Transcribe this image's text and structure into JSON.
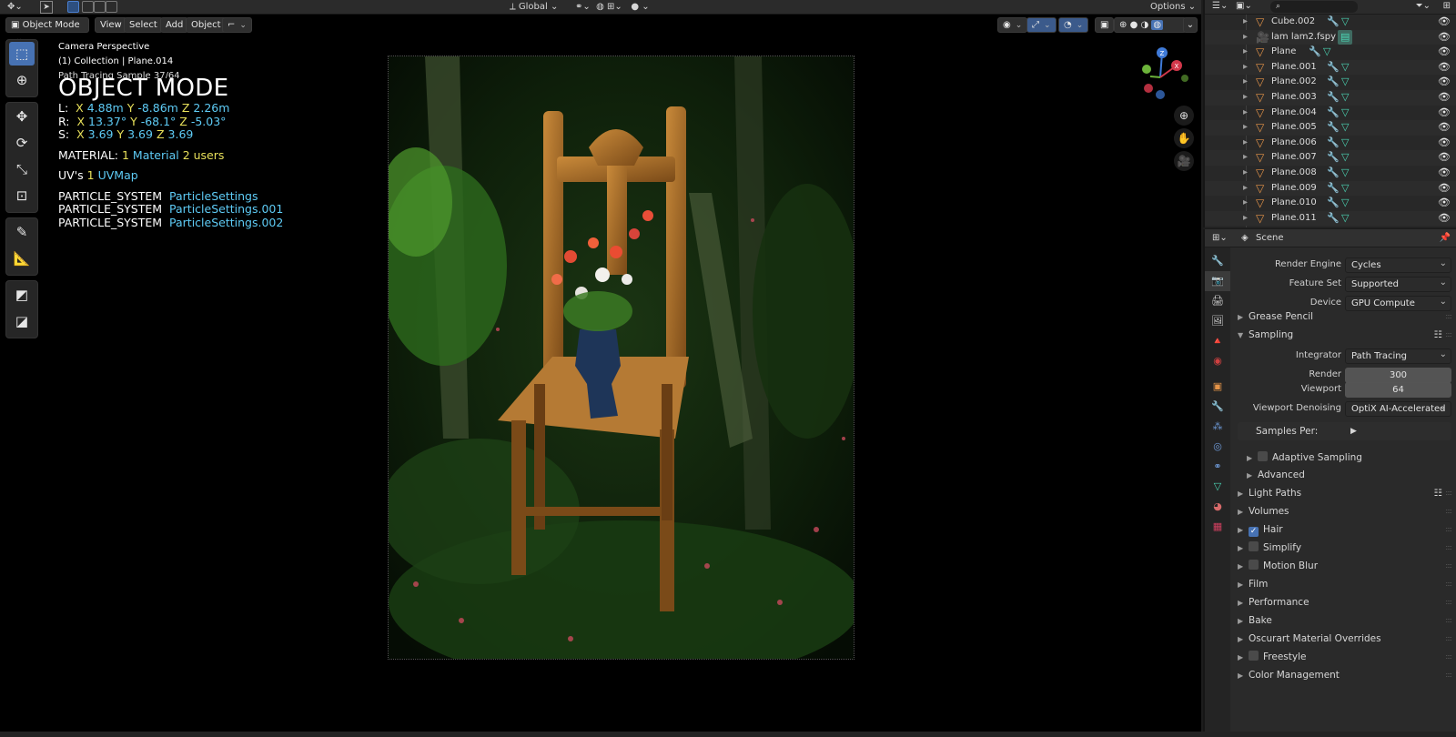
{
  "topbar": {
    "orientation_label": "Global",
    "options_label": "Options"
  },
  "viewport": {
    "mode_button": "Object Mode",
    "menu": [
      "View",
      "Select",
      "Add",
      "Object"
    ],
    "overlay": {
      "camera": "Camera Perspective",
      "collection": "(1) Collection | Plane.014",
      "samples": "Path Tracing Sample 37/64",
      "mode_title": "OBJECT MODE",
      "loc_label": "L:",
      "loc": {
        "x": "4.88m",
        "y": "-8.86m",
        "z": "2.26m"
      },
      "rot_label": "R:",
      "rot": {
        "x": "13.37°",
        "y": "-68.1°",
        "z": "-5.03°"
      },
      "scale_label": "S:",
      "scale": {
        "x": "3.69",
        "y": "3.69",
        "z": "3.69"
      },
      "material_label": "MATERIAL:",
      "material_count": "1",
      "material_name": "Material",
      "material_users": "2 users",
      "uv_label": "UV's",
      "uv_count": "1",
      "uv_name": "UVMap",
      "particle_label": "PARTICLE_SYSTEM",
      "particles": [
        "ParticleSettings",
        "ParticleSettings.001",
        "ParticleSettings.002"
      ]
    },
    "axis_letters": {
      "x": "X",
      "y": "Y",
      "z": "Z"
    }
  },
  "outliner": {
    "rows": [
      {
        "name": "Cube.002",
        "type": "mesh"
      },
      {
        "name": "lam lam2.fspy",
        "type": "camera"
      },
      {
        "name": "Plane",
        "type": "mesh"
      },
      {
        "name": "Plane.001",
        "type": "mesh"
      },
      {
        "name": "Plane.002",
        "type": "mesh"
      },
      {
        "name": "Plane.003",
        "type": "mesh"
      },
      {
        "name": "Plane.004",
        "type": "mesh"
      },
      {
        "name": "Plane.005",
        "type": "mesh"
      },
      {
        "name": "Plane.006",
        "type": "mesh"
      },
      {
        "name": "Plane.007",
        "type": "mesh"
      },
      {
        "name": "Plane.008",
        "type": "mesh"
      },
      {
        "name": "Plane.009",
        "type": "mesh"
      },
      {
        "name": "Plane.010",
        "type": "mesh"
      },
      {
        "name": "Plane.011",
        "type": "mesh"
      }
    ]
  },
  "properties": {
    "context": "Scene",
    "render_engine_label": "Render Engine",
    "render_engine": "Cycles",
    "feature_set_label": "Feature Set",
    "feature_set": "Supported",
    "device_label": "Device",
    "device": "GPU Compute",
    "panels": {
      "grease_pencil": "Grease Pencil",
      "sampling": "Sampling",
      "integrator_label": "Integrator",
      "integrator": "Path Tracing",
      "render_label": "Render",
      "render_samples": "300",
      "viewport_label": "Viewport",
      "viewport_samples": "64",
      "denoise_label": "Viewport Denoising",
      "denoise": "OptiX AI-Accelerated",
      "samples_per": "Samples Per:",
      "adaptive": "Adaptive Sampling",
      "advanced": "Advanced",
      "light_paths": "Light Paths",
      "volumes": "Volumes",
      "hair": "Hair",
      "simplify": "Simplify",
      "motion_blur": "Motion Blur",
      "film": "Film",
      "performance": "Performance",
      "bake": "Bake",
      "oscurart": "Oscurart Material Overrides",
      "freestyle": "Freestyle",
      "color_management": "Color Management"
    }
  },
  "colors": {
    "accent": "#4772b3",
    "axis_yellow": "#e8e05a",
    "value_cyan": "#5ecbf5",
    "object_orange": "#e59448",
    "mesh_teal": "#4bd5b4"
  }
}
